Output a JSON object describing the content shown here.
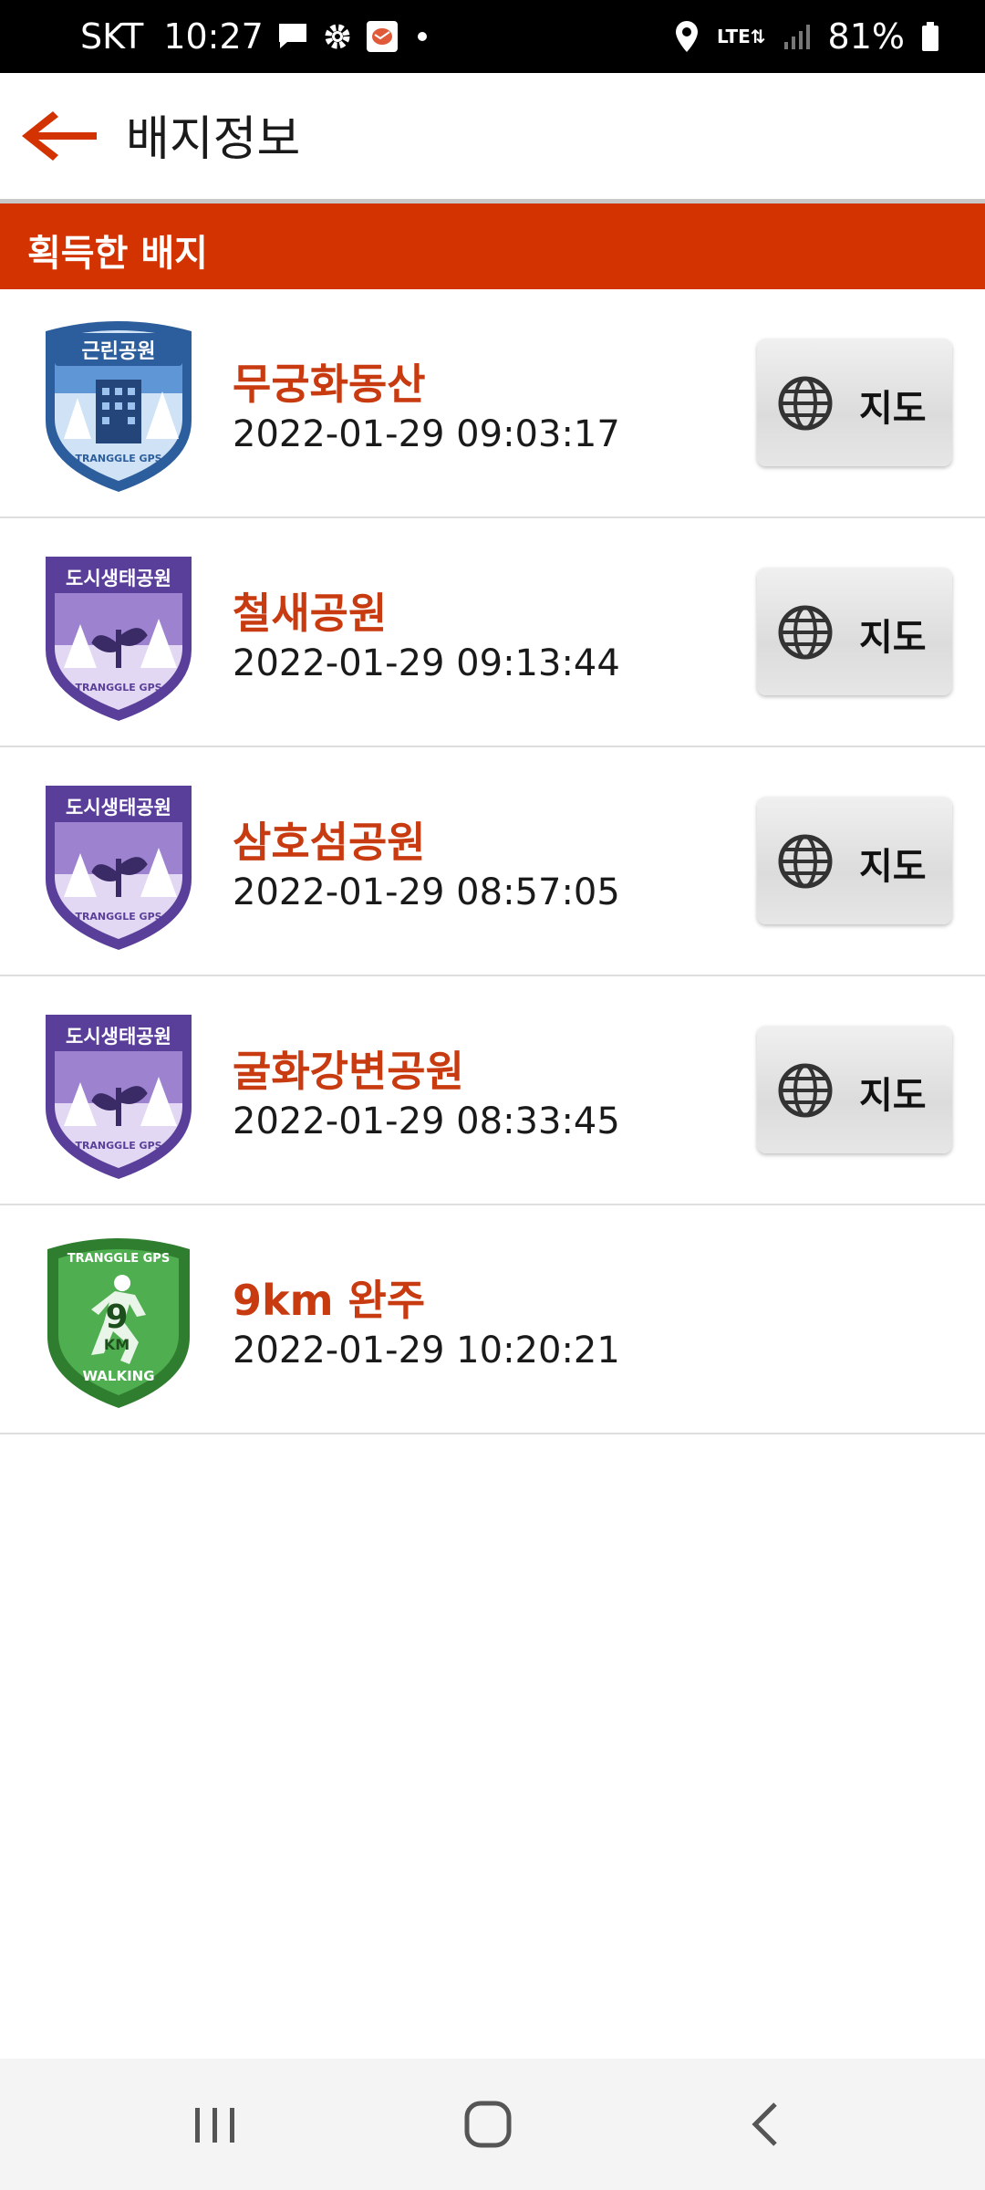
{
  "status_bar": {
    "carrier": "SKT",
    "time": "10:27",
    "network": "LTE",
    "battery": "81%"
  },
  "app_bar": {
    "title": "배지정보"
  },
  "section": {
    "title": "획득한 배지"
  },
  "badges": [
    {
      "name": "무궁화동산",
      "date": "2022-01-29 09:03:17",
      "badge_label": "근린공원",
      "badge_sub": "TRANGGLE GPS",
      "badge_type": "neighborhood-park",
      "map_button": "지도",
      "has_map": true
    },
    {
      "name": "철새공원",
      "date": "2022-01-29 09:13:44",
      "badge_label": "도시생태공원",
      "badge_sub": "TRANGGLE GPS",
      "badge_type": "eco-park",
      "map_button": "지도",
      "has_map": true
    },
    {
      "name": "삼호섬공원",
      "date": "2022-01-29 08:57:05",
      "badge_label": "도시생태공원",
      "badge_sub": "TRANGGLE GPS",
      "badge_type": "eco-park",
      "map_button": "지도",
      "has_map": true
    },
    {
      "name": "굴화강변공원",
      "date": "2022-01-29 08:33:45",
      "badge_label": "도시생태공원",
      "badge_sub": "TRANGGLE GPS",
      "badge_type": "eco-park",
      "map_button": "지도",
      "has_map": true
    },
    {
      "name": "9km 완주",
      "date": "2022-01-29 10:20:21",
      "badge_label": "TRANGGLE GPS",
      "badge_number": "9",
      "badge_unit": "KM",
      "badge_sub": "WALKING",
      "badge_type": "walking-distance",
      "has_map": false
    }
  ],
  "colors": {
    "accent": "#d23300",
    "name_text": "#c83a10",
    "neighborhood_badge": "#3e78bf",
    "eco_badge": "#6a4ea8",
    "walking_badge": "#3d9a3d"
  },
  "icons": {
    "back": "arrow-left-icon",
    "map": "globe-icon",
    "nav_recents": "recents-icon",
    "nav_home": "home-icon",
    "nav_back": "chevron-left-icon"
  }
}
